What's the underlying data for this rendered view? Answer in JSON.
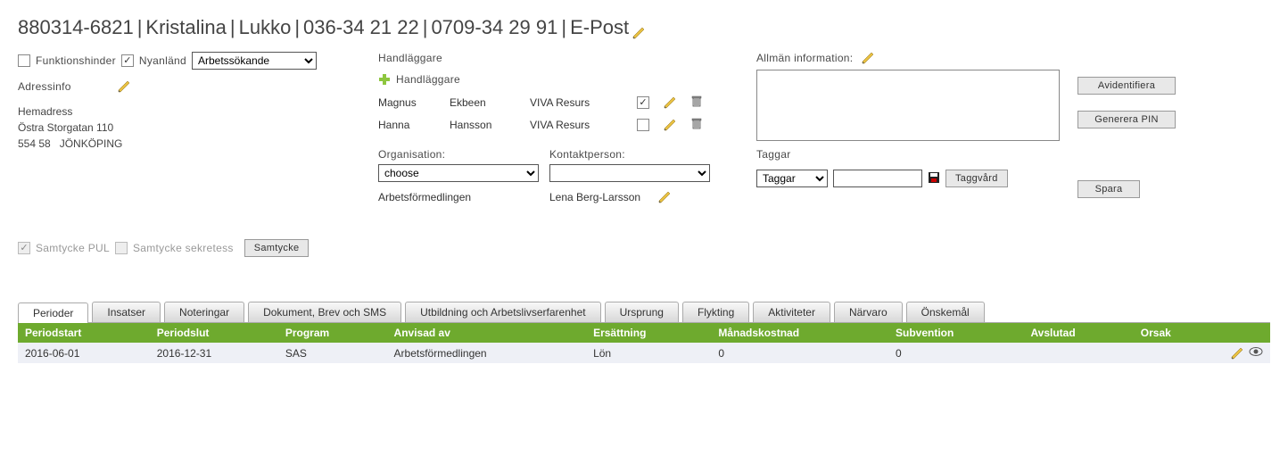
{
  "title_parts": {
    "pnr": "880314-6821",
    "first": "Kristalina",
    "last": "Lukko",
    "phone1": "036-34 21 22",
    "phone2": "0709-34 29 91",
    "email": "E-Post"
  },
  "left": {
    "funktionshinder_label": "Funktionshinder",
    "funktionshinder_checked": false,
    "nyanland_label": "Nyanländ",
    "nyanland_checked": true,
    "status_options": [
      "Arbetssökande"
    ],
    "status_selected": "Arbetssökande",
    "adressinfo_label": "Adressinfo",
    "hemadress_label": "Hemadress",
    "street": "Östra Storgatan 110",
    "postal": "554 58",
    "city": "JÖNKÖPING"
  },
  "mid": {
    "handlaggare_label": "Handläggare",
    "add_label": "Handläggare",
    "rows": [
      {
        "first": "Magnus",
        "last": "Ekbeen",
        "org": "VIVA Resurs",
        "checked": true
      },
      {
        "first": "Hanna",
        "last": "Hansson",
        "org": "VIVA Resurs",
        "checked": false
      }
    ],
    "organisation_label": "Organisation:",
    "organisation_selected": "choose",
    "kontaktperson_label": "Kontaktperson:",
    "kontaktperson_selected": "",
    "org_value": "Arbetsförmedlingen",
    "contact_value": "Lena Berg-Larsson"
  },
  "right": {
    "allman_label": "Allmän information:",
    "allman_value": "",
    "taggar_label": "Taggar",
    "tagg_select": "Taggar",
    "tagg_input": "",
    "taggvard_label": "Taggvård",
    "btn_avidentifiera": "Avidentifiera",
    "btn_generera": "Generera PIN",
    "btn_spara": "Spara"
  },
  "consent": {
    "pul_label": "Samtycke PUL",
    "pul_checked": true,
    "sek_label": "Samtycke sekretess",
    "sek_checked": false,
    "btn": "Samtycke"
  },
  "tabs": [
    {
      "label": "Perioder",
      "active": true
    },
    {
      "label": "Insatser"
    },
    {
      "label": "Noteringar"
    },
    {
      "label": "Dokument, Brev och SMS"
    },
    {
      "label": "Utbildning och Arbetslivserfarenhet"
    },
    {
      "label": "Ursprung"
    },
    {
      "label": "Flykting"
    },
    {
      "label": "Aktiviteter"
    },
    {
      "label": "Närvaro"
    },
    {
      "label": "Önskemål"
    }
  ],
  "period_table": {
    "headers": [
      "Periodstart",
      "Periodslut",
      "Program",
      "Anvisad av",
      "Ersättning",
      "Månadskostnad",
      "Subvention",
      "Avslutad",
      "Orsak"
    ],
    "rows": [
      {
        "start": "2016-06-01",
        "slut": "2016-12-31",
        "program": "SAS",
        "anvisad": "Arbetsförmedlingen",
        "ersattning": "Lön",
        "manad": "0",
        "sub": "0",
        "avslutad": "",
        "orsak": ""
      }
    ]
  }
}
